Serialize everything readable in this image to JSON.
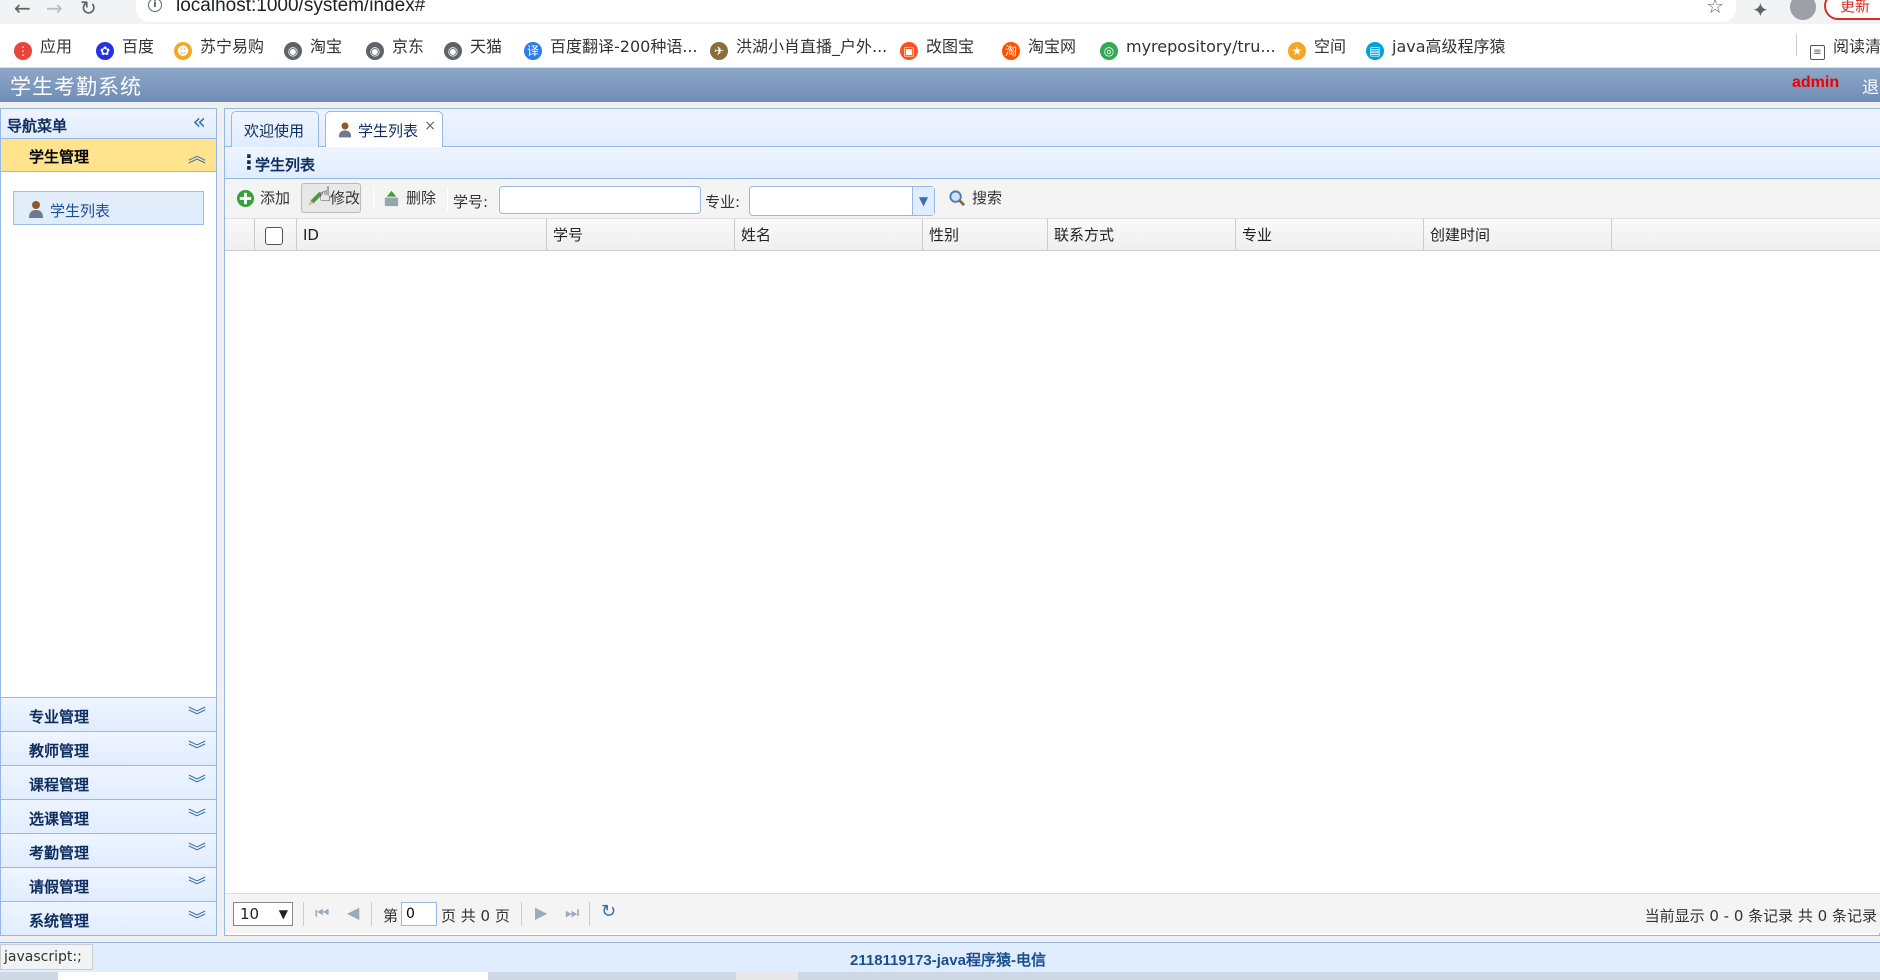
{
  "browser": {
    "url": "localhost:1000/system/index#",
    "update_label": "更新",
    "bookmarks": [
      {
        "label": "应用",
        "icon": "apps-grid-icon",
        "color": "#e8453c"
      },
      {
        "label": "百度",
        "icon": "baidu-paw-icon",
        "color": "#2932e1"
      },
      {
        "label": "苏宁易购",
        "icon": "suning-lion-icon",
        "color": "#f5a623"
      },
      {
        "label": "淘宝",
        "icon": "globe-icon",
        "color": "#5f6368"
      },
      {
        "label": "京东",
        "icon": "globe-icon",
        "color": "#5f6368"
      },
      {
        "label": "天猫",
        "icon": "globe-icon",
        "color": "#5f6368"
      },
      {
        "label": "百度翻译-200种语...",
        "icon": "translate-icon",
        "color": "#2b7ce9"
      },
      {
        "label": "洪湖小肖直播_户外...",
        "icon": "bird-icon",
        "color": "#8a6d3b"
      },
      {
        "label": "改图宝",
        "icon": "gaitubao-icon",
        "color": "#f5541e"
      },
      {
        "label": "淘宝网",
        "icon": "taobao-icon",
        "color": "#ff5000"
      },
      {
        "label": "myrepository/tru...",
        "icon": "chrome-icon",
        "color": "#34a853"
      },
      {
        "label": "空间",
        "icon": "qzone-icon",
        "color": "#f5a623"
      },
      {
        "label": "java高级程序猿",
        "icon": "bilibili-icon",
        "color": "#00a1d6"
      }
    ],
    "reading_list_label": "阅读清",
    "status_url": "javascript:;"
  },
  "app": {
    "title": "学生考勤系统",
    "user": "admin",
    "logout": "退"
  },
  "sidebar": {
    "title": "导航菜单",
    "active_group": "学生管理",
    "active_items": [
      {
        "label": "学生列表",
        "icon": "student-icon"
      }
    ],
    "groups": [
      "专业管理",
      "教师管理",
      "课程管理",
      "选课管理",
      "考勤管理",
      "请假管理",
      "系统管理"
    ]
  },
  "tabs": [
    {
      "label": "欢迎使用",
      "selected": false
    },
    {
      "label": "学生列表",
      "selected": true,
      "icon": "student-icon"
    }
  ],
  "panel": {
    "title": "学生列表",
    "toolbar": {
      "add": "添加",
      "edit": "修改",
      "delete": "删除",
      "student_no_label": "学号:",
      "student_no_value": "",
      "major_label": "专业:",
      "major_value": "",
      "search": "搜索"
    },
    "columns": [
      "ID",
      "学号",
      "姓名",
      "性别",
      "联系方式",
      "专业",
      "创建时间"
    ],
    "rows": []
  },
  "pager": {
    "page_size": "10",
    "page_prefix": "第",
    "page_value": "0",
    "page_suffix": "页 共 0 页",
    "info": "当前显示 0 - 0 条记录 共 0 条记录"
  },
  "footer": {
    "text": "2118119173-java程序猿-电信"
  },
  "colors": {
    "header_bg": "#6f8db6",
    "accent_border": "#95b8e7",
    "active_group_bg": "#ffe48d",
    "user_color": "#e00000"
  }
}
